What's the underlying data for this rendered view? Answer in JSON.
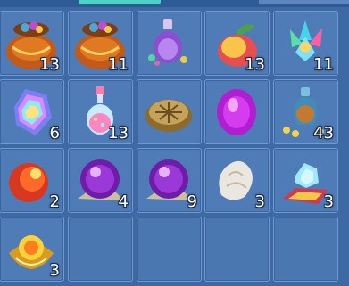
{
  "inventory": {
    "items": [
      {
        "name": "pouch",
        "count": "13"
      },
      {
        "name": "pouch",
        "count": "11"
      },
      {
        "name": "purple-potion-gems",
        "count": ""
      },
      {
        "name": "peach",
        "count": "13"
      },
      {
        "name": "crystal-cluster",
        "count": "11"
      },
      {
        "name": "rainbow-crystal",
        "count": "6"
      },
      {
        "name": "pink-potion",
        "count": "13"
      },
      {
        "name": "turtle-shell",
        "count": ""
      },
      {
        "name": "purple-gem",
        "count": ""
      },
      {
        "name": "vase-gold",
        "count": "43"
      },
      {
        "name": "red-orb",
        "count": "2"
      },
      {
        "name": "purple-orb",
        "count": "4"
      },
      {
        "name": "purple-orb",
        "count": "9"
      },
      {
        "name": "white-jade",
        "count": "3"
      },
      {
        "name": "diamond-carpet",
        "count": "3"
      },
      {
        "name": "golden-ornament",
        "count": "3"
      }
    ]
  },
  "colors": {
    "background": "#3d6aa4",
    "slot": "#4f7bb6",
    "slot_border": "#6f99cf",
    "count_text": "#ffffff"
  }
}
